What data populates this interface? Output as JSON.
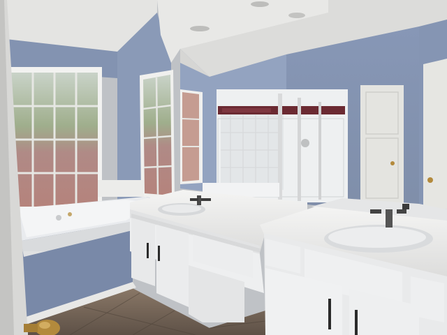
{
  "scene": {
    "kind": "photo",
    "subject": "bathroom-interior",
    "colors": {
      "wall": "#8e9fbd",
      "wall_shadow": "#7a8bab",
      "ceiling": "#e6e6e4",
      "window_glass": "#9aa78a",
      "window_pink": "#b88c8a",
      "tub": "#eceef0",
      "cabinet": "#ecedee",
      "counter": "#f1f1f0",
      "floor": "#7a6a5e",
      "door": "#e2e2de",
      "tile_accent": "#6b2a32",
      "hardware_dark": "#2b2b2b",
      "door_knob": "#b38a3c"
    }
  }
}
